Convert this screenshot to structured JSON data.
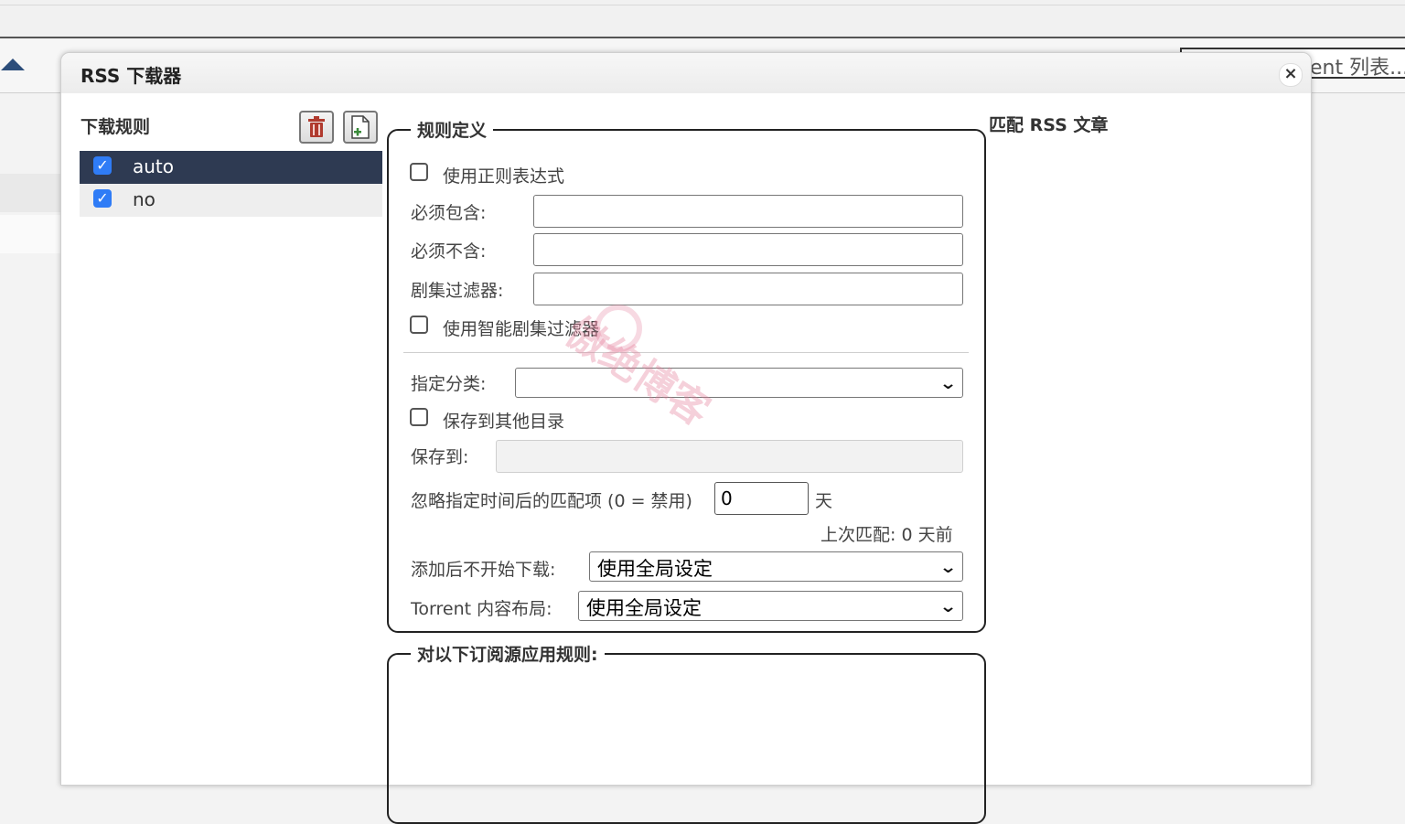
{
  "background": {
    "search_text": "ent 列表..."
  },
  "dialog": {
    "title": "RSS 下载器",
    "close_label": "×",
    "rules_panel": {
      "title": "下载规则",
      "rules": [
        {
          "label": "auto",
          "checked": true,
          "selected": true
        },
        {
          "label": "no",
          "checked": true,
          "selected": false
        }
      ]
    },
    "definition": {
      "legend": "规则定义",
      "use_regex_label": "使用正则表达式",
      "must_contain_label": "必须包含:",
      "must_contain_value": "",
      "must_not_contain_label": "必须不含:",
      "must_not_contain_value": "",
      "episode_filter_label": "剧集过滤器:",
      "episode_filter_value": "",
      "smart_filter_label": "使用智能剧集过滤器",
      "category_label": "指定分类:",
      "category_value": "",
      "save_other_dir_label": "保存到其他目录",
      "save_to_label": "保存到:",
      "save_to_value": "",
      "ignore_label": "忽略指定时间后的匹配项 (0 = 禁用)",
      "ignore_value": "0",
      "ignore_unit": "天",
      "last_match": "上次匹配:  0 天前",
      "add_paused_label": "添加后不开始下载:",
      "add_paused_value": "使用全局设定",
      "layout_label": "Torrent 内容布局:",
      "layout_value": "使用全局设定"
    },
    "feeds": {
      "legend": "对以下订阅源应用规则:"
    },
    "match_title": "匹配 RSS 文章"
  },
  "watermark": "傲绝博客",
  "colors": {
    "selected_row": "#2e3a52",
    "checkbox_blue": "#2f7cf6",
    "delete_icon": "#b03a2e",
    "add_icon": "#3a8a3a"
  }
}
